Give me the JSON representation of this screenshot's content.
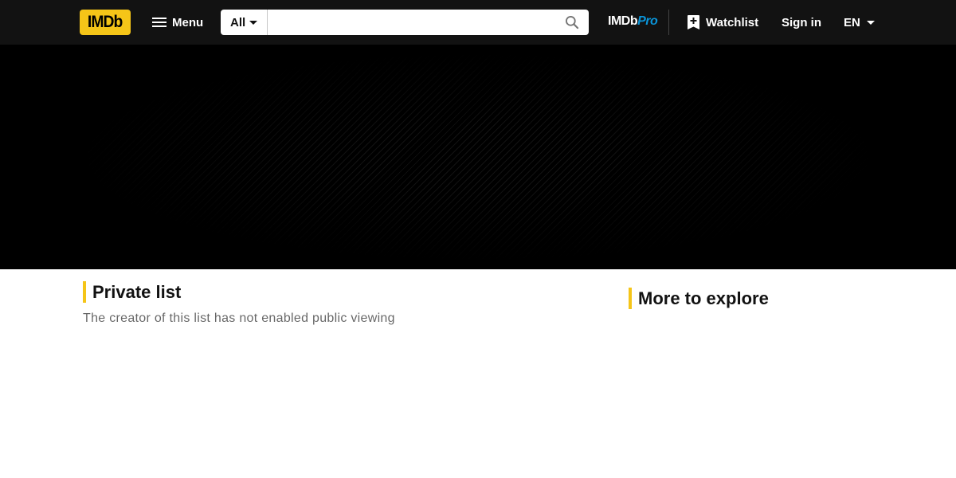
{
  "header": {
    "logo_text": "IMDb",
    "menu_label": "Menu",
    "search": {
      "category": "All",
      "value": "",
      "placeholder": ""
    },
    "pro": {
      "brand": "IMDb",
      "suffix": "Pro"
    },
    "watchlist_label": "Watchlist",
    "signin_label": "Sign in",
    "language": "EN",
    "icons": [
      "hamburger-icon",
      "caret-down-icon",
      "search-icon",
      "bookmark-add-icon"
    ]
  },
  "main": {
    "title": "Private list",
    "subtitle": "The creator of this list has not enabled public viewing"
  },
  "sidebar": {
    "title": "More to explore"
  },
  "colors": {
    "accent": "#f5c518",
    "header_bg": "#121212",
    "hero_bg": "#000000",
    "pro_blue": "#0a94d8"
  }
}
